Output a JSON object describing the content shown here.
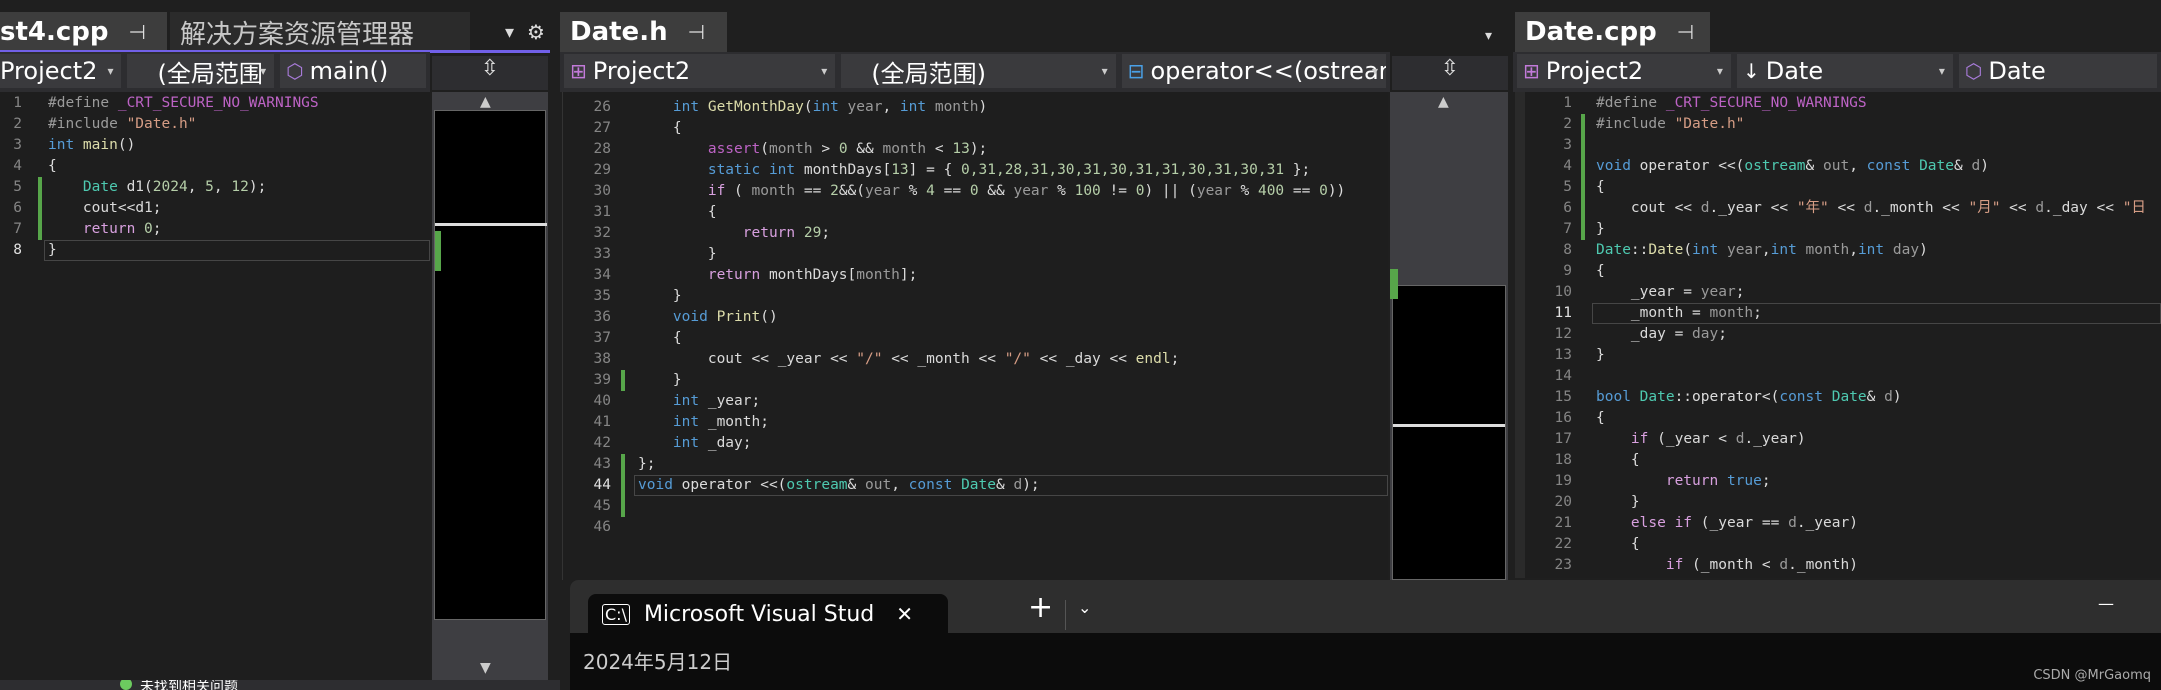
{
  "left": {
    "tab_label": "st4.cpp",
    "tab2_label": "解决方案资源管理器",
    "project": "Project2",
    "scope": "(全局范围",
    "member": "main()",
    "current_line": 8,
    "lines": [
      {
        "n": 1,
        "t": [
          [
            "p",
            "#define "
          ],
          [
            "m",
            "_CRT_SECURE_NO_WARNINGS"
          ]
        ]
      },
      {
        "n": 2,
        "t": [
          [
            "p",
            "#include "
          ],
          [
            "s",
            "\"Date.h\""
          ]
        ]
      },
      {
        "n": 3,
        "t": [
          [
            "k",
            "int "
          ],
          [
            "f",
            "main"
          ],
          [
            "o",
            "()"
          ]
        ]
      },
      {
        "n": 4,
        "t": [
          [
            "o",
            "{"
          ]
        ]
      },
      {
        "n": 5,
        "t": [
          [
            "o",
            "    "
          ],
          [
            "t",
            "Date "
          ],
          [
            "mem",
            "d1"
          ],
          [
            "o",
            "("
          ],
          [
            "n",
            "2024"
          ],
          [
            "o",
            ", "
          ],
          [
            "n",
            "5"
          ],
          [
            "o",
            ", "
          ],
          [
            "n",
            "12"
          ],
          [
            "o",
            ");"
          ]
        ]
      },
      {
        "n": 6,
        "t": [
          [
            "o",
            "    "
          ],
          [
            "mem",
            "cout"
          ],
          [
            "o",
            "<<"
          ],
          [
            "mem",
            "d1"
          ],
          [
            "o",
            ";"
          ]
        ]
      },
      {
        "n": 7,
        "t": [
          [
            "o",
            "    "
          ],
          [
            "c",
            "return "
          ],
          [
            "n",
            "0"
          ],
          [
            "o",
            ";"
          ]
        ]
      },
      {
        "n": 8,
        "t": [
          [
            "o",
            "}"
          ]
        ]
      }
    ],
    "status_text": "未找到相关问题"
  },
  "middle": {
    "tab_label": "Date.h",
    "project": "Project2",
    "scope": "(全局范围)",
    "member": "operator<<(ostrear",
    "current_line": 44,
    "lines": [
      {
        "n": 26,
        "t": [
          [
            "o",
            "    "
          ],
          [
            "k",
            "int "
          ],
          [
            "f",
            "GetMonthDay"
          ],
          [
            "o",
            "("
          ],
          [
            "k",
            "int "
          ],
          [
            "v",
            "year"
          ],
          [
            "o",
            ", "
          ],
          [
            "k",
            "int "
          ],
          [
            "v",
            "month"
          ],
          [
            "o",
            ")"
          ]
        ]
      },
      {
        "n": 27,
        "t": [
          [
            "o",
            "    {"
          ]
        ]
      },
      {
        "n": 28,
        "t": [
          [
            "o",
            "        "
          ],
          [
            "m",
            "assert"
          ],
          [
            "o",
            "("
          ],
          [
            "v",
            "month"
          ],
          [
            "o",
            " > "
          ],
          [
            "n",
            "0"
          ],
          [
            "o",
            " && "
          ],
          [
            "v",
            "month"
          ],
          [
            "o",
            " < "
          ],
          [
            "n",
            "13"
          ],
          [
            "o",
            ");"
          ]
        ]
      },
      {
        "n": 29,
        "t": [
          [
            "o",
            "        "
          ],
          [
            "k",
            "static int "
          ],
          [
            "mem",
            "monthDays"
          ],
          [
            "o",
            "["
          ],
          [
            "n",
            "13"
          ],
          [
            "o",
            "] = { "
          ],
          [
            "n",
            "0,31,28,31,30,31,30,31,31,30,31,30,31"
          ],
          [
            "o",
            " };"
          ]
        ]
      },
      {
        "n": 30,
        "t": [
          [
            "o",
            "        "
          ],
          [
            "c",
            "if"
          ],
          [
            "o",
            " ( "
          ],
          [
            "v",
            "month"
          ],
          [
            "o",
            " == "
          ],
          [
            "n",
            "2"
          ],
          [
            "o",
            "&&("
          ],
          [
            "v",
            "year"
          ],
          [
            "o",
            " % "
          ],
          [
            "n",
            "4"
          ],
          [
            "o",
            " == "
          ],
          [
            "n",
            "0"
          ],
          [
            "o",
            " && "
          ],
          [
            "v",
            "year"
          ],
          [
            "o",
            " % "
          ],
          [
            "n",
            "100"
          ],
          [
            "o",
            " != "
          ],
          [
            "n",
            "0"
          ],
          [
            "o",
            ") || ("
          ],
          [
            "v",
            "year"
          ],
          [
            "o",
            " % "
          ],
          [
            "n",
            "400"
          ],
          [
            "o",
            " == "
          ],
          [
            "n",
            "0"
          ],
          [
            "o",
            "))"
          ]
        ]
      },
      {
        "n": 31,
        "t": [
          [
            "o",
            "        {"
          ]
        ]
      },
      {
        "n": 32,
        "t": [
          [
            "o",
            "            "
          ],
          [
            "c",
            "return "
          ],
          [
            "n",
            "29"
          ],
          [
            "o",
            ";"
          ]
        ]
      },
      {
        "n": 33,
        "t": [
          [
            "o",
            "        }"
          ]
        ]
      },
      {
        "n": 34,
        "t": [
          [
            "o",
            "        "
          ],
          [
            "c",
            "return "
          ],
          [
            "mem",
            "monthDays"
          ],
          [
            "o",
            "["
          ],
          [
            "v",
            "month"
          ],
          [
            "o",
            "];"
          ]
        ]
      },
      {
        "n": 35,
        "t": [
          [
            "o",
            "    }"
          ]
        ]
      },
      {
        "n": 36,
        "t": [
          [
            "o",
            "    "
          ],
          [
            "k",
            "void "
          ],
          [
            "f",
            "Print"
          ],
          [
            "o",
            "()"
          ]
        ]
      },
      {
        "n": 37,
        "t": [
          [
            "o",
            "    {"
          ]
        ]
      },
      {
        "n": 38,
        "t": [
          [
            "o",
            "        "
          ],
          [
            "mem",
            "cout"
          ],
          [
            "o",
            " << "
          ],
          [
            "mem",
            "_year"
          ],
          [
            "o",
            " << "
          ],
          [
            "s",
            "\"/\""
          ],
          [
            "o",
            " << "
          ],
          [
            "mem",
            "_month"
          ],
          [
            "o",
            " << "
          ],
          [
            "s",
            "\"/\""
          ],
          [
            "o",
            " << "
          ],
          [
            "mem",
            "_day"
          ],
          [
            "o",
            " << "
          ],
          [
            "f",
            "endl"
          ],
          [
            "o",
            ";"
          ]
        ]
      },
      {
        "n": 39,
        "t": [
          [
            "o",
            "    }"
          ]
        ]
      },
      {
        "n": 40,
        "t": [
          [
            "o",
            "    "
          ],
          [
            "k",
            "int "
          ],
          [
            "mem",
            "_year"
          ],
          [
            "o",
            ";"
          ]
        ]
      },
      {
        "n": 41,
        "t": [
          [
            "o",
            "    "
          ],
          [
            "k",
            "int "
          ],
          [
            "mem",
            "_month"
          ],
          [
            "o",
            ";"
          ]
        ]
      },
      {
        "n": 42,
        "t": [
          [
            "o",
            "    "
          ],
          [
            "k",
            "int "
          ],
          [
            "mem",
            "_day"
          ],
          [
            "o",
            ";"
          ]
        ]
      },
      {
        "n": 43,
        "t": [
          [
            "o",
            "};"
          ]
        ]
      },
      {
        "n": 44,
        "t": [
          [
            "k",
            "void "
          ],
          [
            "o",
            "operator <<("
          ],
          [
            "t",
            "ostream"
          ],
          [
            "o",
            "& "
          ],
          [
            "v",
            "out"
          ],
          [
            "o",
            ", "
          ],
          [
            "k",
            "const "
          ],
          [
            "t",
            "Date"
          ],
          [
            "o",
            "& "
          ],
          [
            "v",
            "d"
          ],
          [
            "o",
            ");"
          ]
        ]
      },
      {
        "n": 45,
        "t": []
      },
      {
        "n": 46,
        "t": []
      }
    ]
  },
  "right": {
    "tab_label": "Date.cpp",
    "project": "Project2",
    "scope": "Date",
    "member": "Date",
    "current_line": 11,
    "lines": [
      {
        "n": 1,
        "t": [
          [
            "p",
            "#define "
          ],
          [
            "m",
            "_CRT_SECURE_NO_WARNINGS"
          ]
        ]
      },
      {
        "n": 2,
        "t": [
          [
            "p",
            "#include "
          ],
          [
            "s",
            "\"Date.h\""
          ]
        ]
      },
      {
        "n": 3,
        "t": []
      },
      {
        "n": 4,
        "t": [
          [
            "k",
            "void "
          ],
          [
            "o",
            "operator <<("
          ],
          [
            "t",
            "ostream"
          ],
          [
            "o",
            "& "
          ],
          [
            "v",
            "out"
          ],
          [
            "o",
            ", "
          ],
          [
            "k",
            "const "
          ],
          [
            "t",
            "Date"
          ],
          [
            "o",
            "& "
          ],
          [
            "v",
            "d"
          ],
          [
            "o",
            ")"
          ]
        ]
      },
      {
        "n": 5,
        "t": [
          [
            "o",
            "{"
          ]
        ]
      },
      {
        "n": 6,
        "t": [
          [
            "o",
            "    "
          ],
          [
            "mem",
            "cout"
          ],
          [
            "o",
            " << "
          ],
          [
            "v",
            "d"
          ],
          [
            "o",
            "."
          ],
          [
            "mem",
            "_year"
          ],
          [
            "o",
            " << "
          ],
          [
            "s",
            "\"年\""
          ],
          [
            "o",
            " << "
          ],
          [
            "v",
            "d"
          ],
          [
            "o",
            "."
          ],
          [
            "mem",
            "_month"
          ],
          [
            "o",
            " << "
          ],
          [
            "s",
            "\"月\""
          ],
          [
            "o",
            " << "
          ],
          [
            "v",
            "d"
          ],
          [
            "o",
            "."
          ],
          [
            "mem",
            "_day"
          ],
          [
            "o",
            " << "
          ],
          [
            "s",
            "\"日"
          ]
        ]
      },
      {
        "n": 7,
        "t": [
          [
            "o",
            "}"
          ]
        ]
      },
      {
        "n": 8,
        "t": [
          [
            "t",
            "Date"
          ],
          [
            "o",
            "::"
          ],
          [
            "f",
            "Date"
          ],
          [
            "o",
            "("
          ],
          [
            "k",
            "int "
          ],
          [
            "v",
            "year"
          ],
          [
            "o",
            ","
          ],
          [
            "k",
            "int "
          ],
          [
            "v",
            "month"
          ],
          [
            "o",
            ","
          ],
          [
            "k",
            "int "
          ],
          [
            "v",
            "day"
          ],
          [
            "o",
            ")"
          ]
        ]
      },
      {
        "n": 9,
        "t": [
          [
            "o",
            "{"
          ]
        ]
      },
      {
        "n": 10,
        "t": [
          [
            "o",
            "    "
          ],
          [
            "mem",
            "_year"
          ],
          [
            "o",
            " = "
          ],
          [
            "v",
            "year"
          ],
          [
            "o",
            ";"
          ]
        ]
      },
      {
        "n": 11,
        "t": [
          [
            "o",
            "    "
          ],
          [
            "mem",
            "_month"
          ],
          [
            "o",
            " = "
          ],
          [
            "v",
            "month"
          ],
          [
            "o",
            ";"
          ]
        ]
      },
      {
        "n": 12,
        "t": [
          [
            "o",
            "    "
          ],
          [
            "mem",
            "_day"
          ],
          [
            "o",
            " = "
          ],
          [
            "v",
            "day"
          ],
          [
            "o",
            ";"
          ]
        ]
      },
      {
        "n": 13,
        "t": [
          [
            "o",
            "}"
          ]
        ]
      },
      {
        "n": 14,
        "t": []
      },
      {
        "n": 15,
        "t": [
          [
            "k",
            "bool "
          ],
          [
            "t",
            "Date"
          ],
          [
            "o",
            "::operator<("
          ],
          [
            "k",
            "const "
          ],
          [
            "t",
            "Date"
          ],
          [
            "o",
            "& "
          ],
          [
            "v",
            "d"
          ],
          [
            "o",
            ")"
          ]
        ]
      },
      {
        "n": 16,
        "t": [
          [
            "o",
            "{"
          ]
        ]
      },
      {
        "n": 17,
        "t": [
          [
            "o",
            "    "
          ],
          [
            "c",
            "if"
          ],
          [
            "o",
            " ("
          ],
          [
            "mem",
            "_year"
          ],
          [
            "o",
            " < "
          ],
          [
            "v",
            "d"
          ],
          [
            "o",
            "."
          ],
          [
            "mem",
            "_year"
          ],
          [
            "o",
            ")"
          ]
        ]
      },
      {
        "n": 18,
        "t": [
          [
            "o",
            "    {"
          ]
        ]
      },
      {
        "n": 19,
        "t": [
          [
            "o",
            "        "
          ],
          [
            "c",
            "return "
          ],
          [
            "k",
            "true"
          ],
          [
            "o",
            ";"
          ]
        ]
      },
      {
        "n": 20,
        "t": [
          [
            "o",
            "    }"
          ]
        ]
      },
      {
        "n": 21,
        "t": [
          [
            "o",
            "    "
          ],
          [
            "c",
            "else if"
          ],
          [
            "o",
            " ("
          ],
          [
            "mem",
            "_year"
          ],
          [
            "o",
            " == "
          ],
          [
            "v",
            "d"
          ],
          [
            "o",
            "."
          ],
          [
            "mem",
            "_year"
          ],
          [
            "o",
            ")"
          ]
        ]
      },
      {
        "n": 22,
        "t": [
          [
            "o",
            "    {"
          ]
        ]
      },
      {
        "n": 23,
        "t": [
          [
            "o",
            "        "
          ],
          [
            "c",
            "if"
          ],
          [
            "o",
            " ("
          ],
          [
            "mem",
            "_month"
          ],
          [
            "o",
            " < "
          ],
          [
            "v",
            "d"
          ],
          [
            "o",
            "."
          ],
          [
            "mem",
            "_month"
          ],
          [
            "o",
            ")"
          ]
        ]
      }
    ]
  },
  "terminal": {
    "tab_title": "Microsoft Visual Stud",
    "output": "2024年5月12日",
    "new_tab": "+",
    "dropdown": "⌄",
    "minimize": "—"
  },
  "watermark": "CSDN @MrGaomq",
  "icons": {
    "pin": "⊣",
    "close": "✕",
    "caret": "▾",
    "gear": "⚙",
    "splitter": "⇳",
    "up": "▲",
    "down": "▼"
  },
  "colors": {
    "accent": "#7160e8",
    "change_marker": "#57a64a",
    "keyword": "#569cd6",
    "type": "#4ec9b0",
    "string": "#d69d85"
  }
}
